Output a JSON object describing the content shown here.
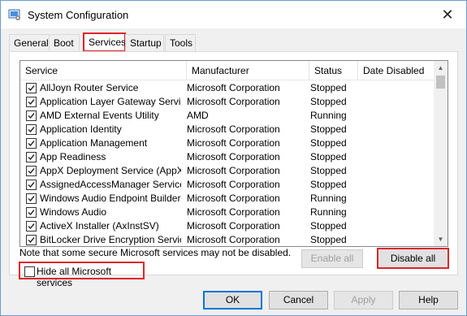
{
  "window": {
    "title": "System Configuration",
    "close_symbol": "✕"
  },
  "tabs": [
    {
      "label": "General",
      "active": false
    },
    {
      "label": "Boot",
      "active": false
    },
    {
      "label": "Services",
      "active": true
    },
    {
      "label": "Startup",
      "active": false
    },
    {
      "label": "Tools",
      "active": false
    }
  ],
  "services": {
    "columns": [
      "Service",
      "Manufacturer",
      "Status",
      "Date Disabled"
    ],
    "rows": [
      {
        "checked": true,
        "service": "AllJoyn Router Service",
        "manufacturer": "Microsoft Corporation",
        "status": "Stopped",
        "date_disabled": ""
      },
      {
        "checked": true,
        "service": "Application Layer Gateway Service",
        "manufacturer": "Microsoft Corporation",
        "status": "Stopped",
        "date_disabled": ""
      },
      {
        "checked": true,
        "service": "AMD External Events Utility",
        "manufacturer": "AMD",
        "status": "Running",
        "date_disabled": ""
      },
      {
        "checked": true,
        "service": "Application Identity",
        "manufacturer": "Microsoft Corporation",
        "status": "Stopped",
        "date_disabled": ""
      },
      {
        "checked": true,
        "service": "Application Management",
        "manufacturer": "Microsoft Corporation",
        "status": "Stopped",
        "date_disabled": ""
      },
      {
        "checked": true,
        "service": "App Readiness",
        "manufacturer": "Microsoft Corporation",
        "status": "Stopped",
        "date_disabled": ""
      },
      {
        "checked": true,
        "service": "AppX Deployment Service (AppX...",
        "manufacturer": "Microsoft Corporation",
        "status": "Stopped",
        "date_disabled": ""
      },
      {
        "checked": true,
        "service": "AssignedAccessManager Service",
        "manufacturer": "Microsoft Corporation",
        "status": "Stopped",
        "date_disabled": ""
      },
      {
        "checked": true,
        "service": "Windows Audio Endpoint Builder",
        "manufacturer": "Microsoft Corporation",
        "status": "Running",
        "date_disabled": ""
      },
      {
        "checked": true,
        "service": "Windows Audio",
        "manufacturer": "Microsoft Corporation",
        "status": "Running",
        "date_disabled": ""
      },
      {
        "checked": true,
        "service": "ActiveX Installer (AxInstSV)",
        "manufacturer": "Microsoft Corporation",
        "status": "Stopped",
        "date_disabled": ""
      },
      {
        "checked": true,
        "service": "BitLocker Drive Encryption Service",
        "manufacturer": "Microsoft Corporation",
        "status": "Stopped",
        "date_disabled": ""
      }
    ]
  },
  "note": "Note that some secure Microsoft services may not be disabled.",
  "buttons": {
    "enable_all": "Enable all",
    "disable_all": "Disable all",
    "ok": "OK",
    "cancel": "Cancel",
    "apply": "Apply",
    "help": "Help"
  },
  "hide_ms": {
    "label": "Hide all Microsoft services",
    "checked": false
  },
  "colors": {
    "highlight": "#e0242b",
    "window_border": "#6b9bd1"
  }
}
